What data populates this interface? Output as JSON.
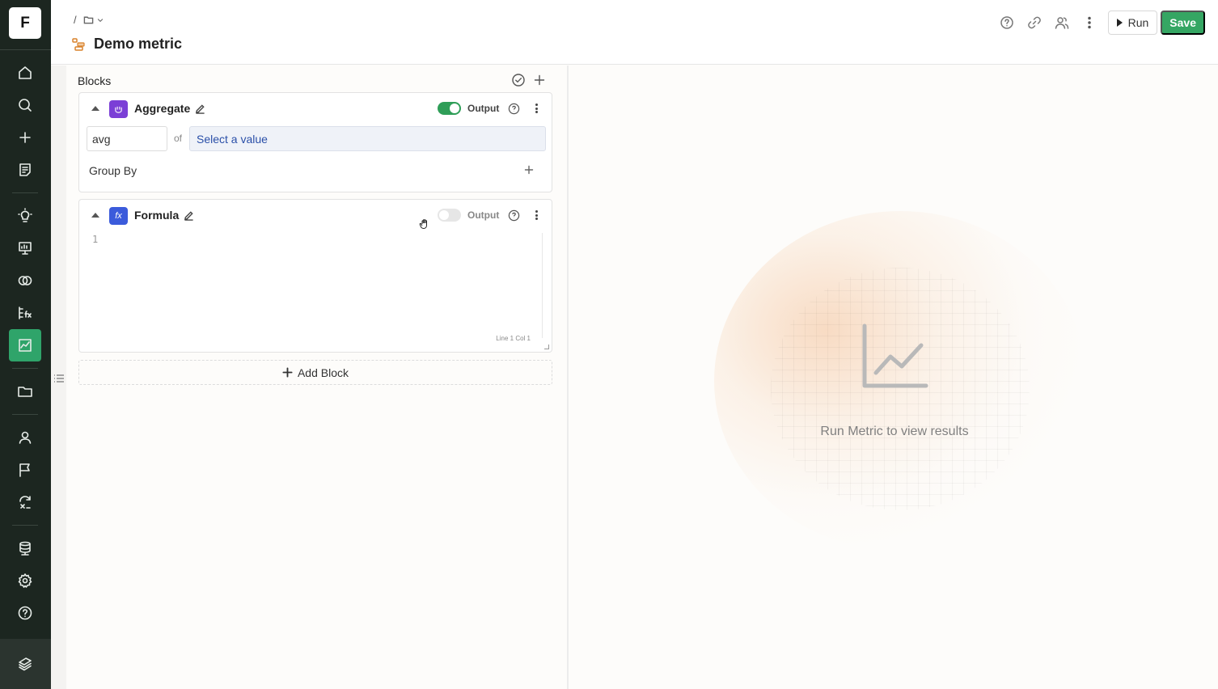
{
  "rail": {
    "logo": "F",
    "items": [
      {
        "icon": "home-icon"
      },
      {
        "icon": "search-icon"
      },
      {
        "icon": "plus-icon"
      },
      {
        "icon": "notebook-icon"
      },
      {
        "icon": "lightbulb-icon"
      },
      {
        "icon": "presentation-icon"
      },
      {
        "icon": "overlap-circles-icon"
      },
      {
        "icon": "formula-icon"
      },
      {
        "icon": "metric-chart-icon",
        "active": true
      },
      {
        "icon": "folder-icon"
      },
      {
        "icon": "user-icon"
      },
      {
        "icon": "flag-icon"
      },
      {
        "icon": "transform-icon"
      },
      {
        "icon": "database-icon"
      },
      {
        "icon": "settings-gear-icon"
      },
      {
        "icon": "help-icon"
      },
      {
        "icon": "stack-logo-icon"
      }
    ]
  },
  "header": {
    "breadcrumb_sep": "/",
    "title": "Demo metric",
    "run_label": "Run",
    "save_label": "Save"
  },
  "blocks": {
    "title": "Blocks",
    "aggregate": {
      "name": "Aggregate",
      "output_label": "Output",
      "output_on": true,
      "function_value": "avg",
      "of_label": "of",
      "select_placeholder": "Select a value",
      "group_by_label": "Group By"
    },
    "formula": {
      "name": "Formula",
      "badge": "fx",
      "output_label": "Output",
      "output_on": false,
      "line_number": "1",
      "cursor_position": "Line 1 Col 1"
    },
    "add_block_label": "Add Block"
  },
  "results": {
    "empty_message": "Run Metric to view results"
  },
  "colors": {
    "rail_bg": "#1c2620",
    "rail_active": "#2fa46a",
    "save_button": "#35a663",
    "aggregate_badge": "#7b3fd6",
    "formula_badge": "#3b5bdb",
    "toggle_on": "#2f9e58"
  }
}
